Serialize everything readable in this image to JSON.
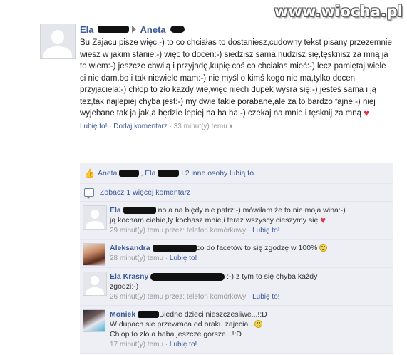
{
  "watermark": "www.wiocha.pl",
  "post": {
    "author": "Ela",
    "recipient": "Aneta",
    "text": "Bu Zajacu pisze więc:-) to co chciałas to dostaniesz,cudowny tekst pisany przezemnie wiesz w jakim stanie:-) więc to docen:-) siedzisz sama,nudzisz się,tęsknisz za mną ja to wiem:-) jeszcze chwilą i przyjadę,kupię coś co chciałas mieć:-) lecz pamiętaj wiele ci nie dam,bo i tak niewiele mam:-) nie myśl o kimś kogo nie ma,tylko docen przyjaciela:-) chłop to zło każdy wie,więc niech dupek wysra się:-) jesteś sama i ją też,tak najlepiej chyba jest:-) my dwie takie porabane,ale za to bardzo fajne:-) niej wyjebane tak ja jak,a będzie lepiej ha ha ha:-) czekaj na mnie i tęsknij za mną",
    "like_label": "Lubię to!",
    "comment_label": "Dodaj komentarz",
    "time": "33 minut(y) temu",
    "sep": " · "
  },
  "likes": {
    "name1": "Aneta",
    "name2": ", Ela",
    "rest": "i 2 inne osoby lubią to."
  },
  "more_comments": "Zobacz 1 więcej komentarz",
  "comments": [
    {
      "name": "Ela",
      "text_a": "no a na błędy nie patrz:-) mówiłam że to nie moja wina:-)",
      "text_b": "ją kocham ciebie,ty kochasz mnie,i teraz wszyscy cieszymy się",
      "time": "29 minut(y) temu przez: telefon komórkowy",
      "like": "Lubię to!"
    },
    {
      "name": "Aleksandra",
      "text_a": "co do facetów to się zgodzę w 100%",
      "time": "28 minut(y) temu",
      "like": "Lubię to!"
    },
    {
      "name": "Ela Krasny",
      "text_a": ":-) z tym to się chyba każdy",
      "text_b": "zgodzi:-)",
      "time": "26 minut(y) temu przez: telefon komórkowy",
      "like": "Lubię to!"
    },
    {
      "name": "Moniek",
      "text_a": "Biedne dzieci nieszczesliwe...!:D",
      "text_b": "W dupach sie przewraca od braku zajecia...",
      "text_c": "Chlop to zlo a baba jeszcze gorsze...!:D",
      "time": "17 minut(y) temu",
      "like": "Lubię to!"
    }
  ],
  "colors": {
    "link": "#3b5998",
    "comment_bg": "#edeff4",
    "meta": "#999999"
  }
}
